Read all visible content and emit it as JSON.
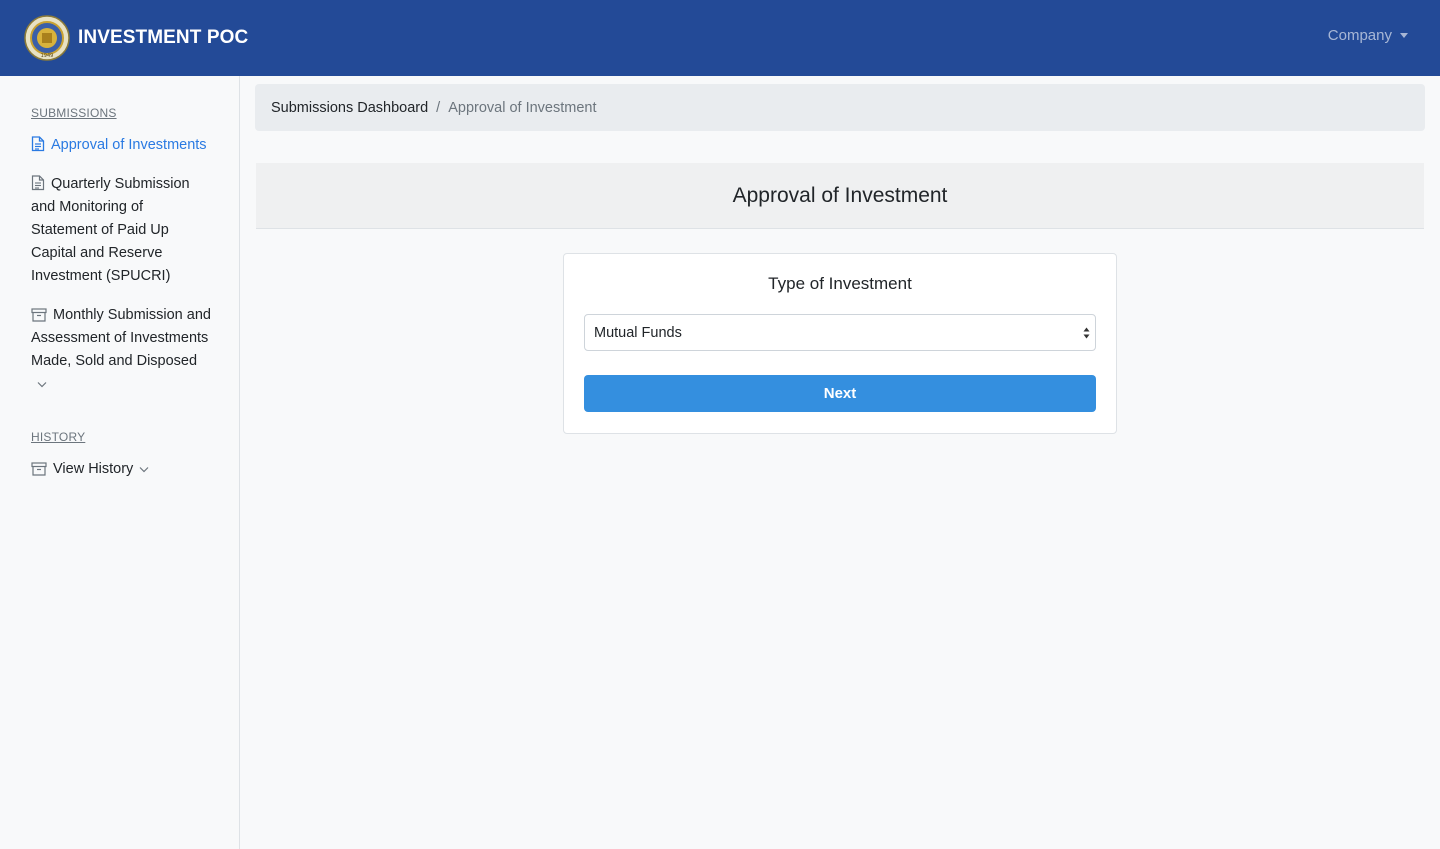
{
  "navbar": {
    "brand": "INVESTMENT POC",
    "company_menu": "Company",
    "logo_icon": "commission-seal-icon"
  },
  "sidebar": {
    "submissions_heading": "SUBMISSIONS",
    "items": [
      {
        "label": "Approval of Investments",
        "icon": "document-icon",
        "active": true
      },
      {
        "label": "Quarterly Submission and Monitoring of Statement of Paid Up Capital and Reserve Investment (SPUCRI)",
        "icon": "document-icon"
      },
      {
        "label": "Monthly Submission and Assessment of Investments Made, Sold and Disposed",
        "icon": "archive-box-icon",
        "expandable": true
      }
    ],
    "history_heading": "HISTORY",
    "history_items": [
      {
        "label": "View History",
        "icon": "archive-box-icon",
        "expandable": true
      }
    ]
  },
  "breadcrumb": {
    "home": "Submissions Dashboard",
    "separator": "/",
    "current": "Approval of Investment"
  },
  "page": {
    "title": "Approval of Investment"
  },
  "form": {
    "label": "Type of Investment",
    "selected": "Mutual Funds",
    "next_label": "Next"
  },
  "colors": {
    "navbar": "#234a97",
    "accent": "#348fdf",
    "active_link": "#2a7ae2"
  }
}
